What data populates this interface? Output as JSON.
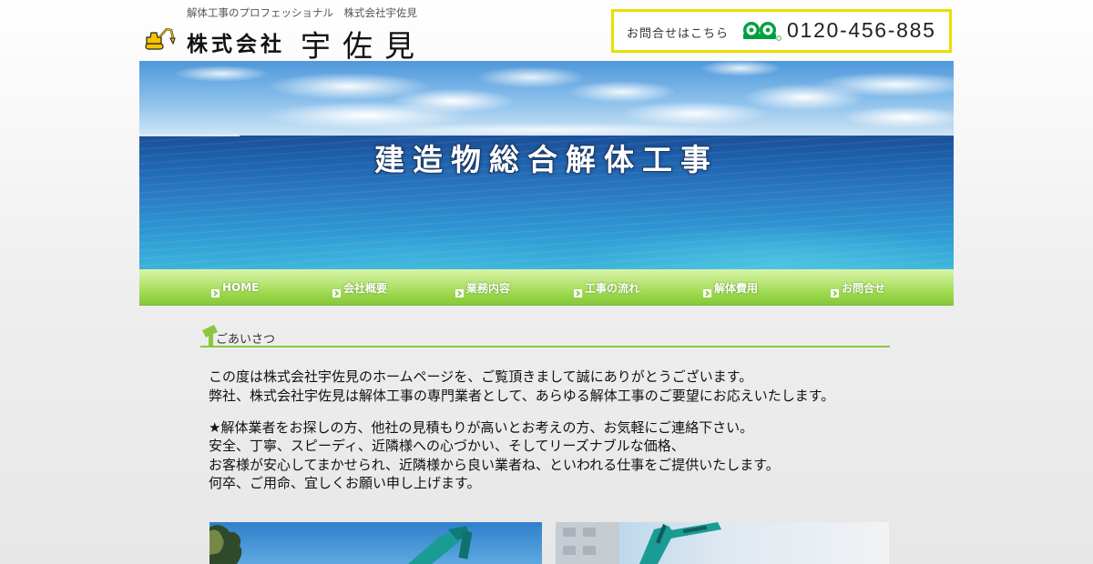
{
  "header": {
    "tagline": "解体工事のプロフェッショナル　株式会社宇佐見",
    "logo": {
      "prefix": "株式会社",
      "name": "宇佐見",
      "icon": "excavator-icon"
    },
    "contact": {
      "label": "お問合せはこちら",
      "phone": "0120-456-885",
      "icon": "free-dial-icon"
    }
  },
  "hero": {
    "title": "建造物総合解体工事"
  },
  "nav": {
    "items": [
      {
        "label": "HOME",
        "icon": "arrow-right-icon"
      },
      {
        "label": "会社概要",
        "icon": "arrow-right-icon"
      },
      {
        "label": "業務内容",
        "icon": "arrow-right-icon"
      },
      {
        "label": "工事の流れ",
        "icon": "arrow-right-icon"
      },
      {
        "label": "解体費用",
        "icon": "arrow-right-icon"
      },
      {
        "label": "お問合せ",
        "icon": "arrow-right-icon"
      }
    ]
  },
  "greeting": {
    "heading": "ごあいさつ",
    "heading_icon": "hammer-icon",
    "paragraphs": [
      [
        "この度は株式会社宇佐見のホームページを、ご覧頂きまして誠にありがとうございます。",
        "弊社、株式会社宇佐見は解体工事の専門業者として、あらゆる解体工事のご要望にお応えいたします。"
      ],
      [
        "★解体業者をお探しの方、他社の見積もりが高いとお考えの方、お気軽にご連絡下さい。",
        "安全、丁寧、スピーディ、近隣様への心づかい、そしてリーズナブルな価格、",
        "お客様が安心してまかせられ、近隣様から良い業者ね、といわれる仕事をご提供いたします。",
        "何卒、ご用命、宜しくお願い申し上げます。"
      ]
    ]
  },
  "colors": {
    "accent": "#8dc63f",
    "nav_green": "#9bd84b",
    "contact_border": "#ecdd00",
    "free_dial_green": "#00a040",
    "logo_yellow": "#f5c400"
  }
}
